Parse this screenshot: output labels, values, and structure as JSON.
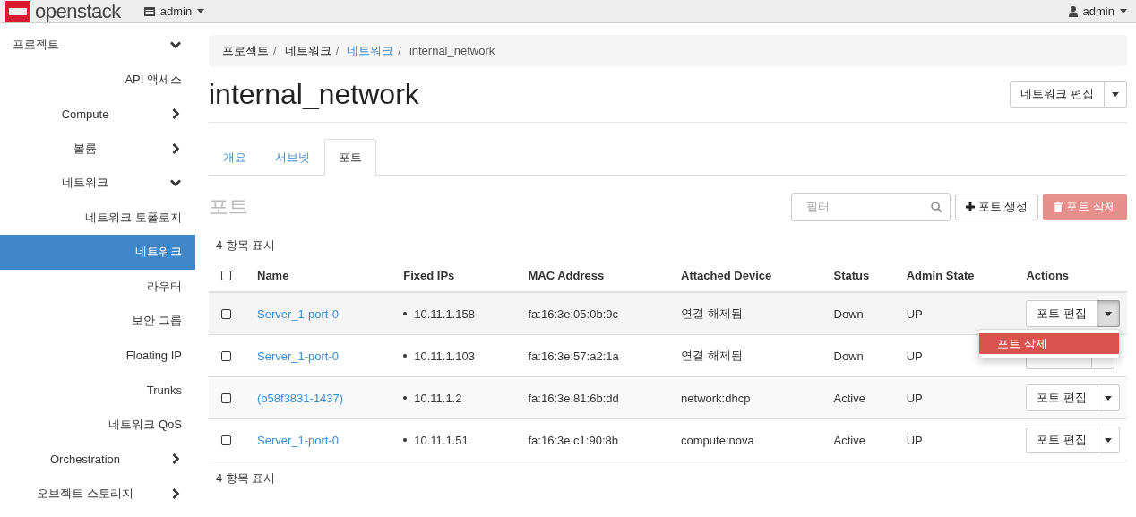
{
  "topbar": {
    "brand": "openstack",
    "project_menu": "admin",
    "user_menu": "admin"
  },
  "sidebar": {
    "items": [
      {
        "label": "프로젝트",
        "expanded": true,
        "children": [
          {
            "label": "API 액세스",
            "selected": false
          },
          {
            "label": "Compute",
            "expanded": false
          },
          {
            "label": "볼륨",
            "expanded": false
          },
          {
            "label": "네트워크",
            "expanded": true,
            "children": [
              {
                "label": "네트워크 토폴로지",
                "selected": false
              },
              {
                "label": "네트워크",
                "selected": true
              },
              {
                "label": "라우터",
                "selected": false
              },
              {
                "label": "보안 그룹",
                "selected": false
              },
              {
                "label": "Floating IP",
                "selected": false
              },
              {
                "label": "Trunks",
                "selected": false
              },
              {
                "label": "네트워크 QoS",
                "selected": false
              }
            ]
          },
          {
            "label": "Orchestration",
            "expanded": false
          },
          {
            "label": "오브젝트 스토리지",
            "expanded": false
          }
        ]
      }
    ]
  },
  "breadcrumb": {
    "separator": "/",
    "items": [
      {
        "label": "프로젝트",
        "link": false
      },
      {
        "label": "네트워크",
        "link": false
      },
      {
        "label": "네트워크",
        "link": true
      },
      {
        "label": "internal_network",
        "link": false
      }
    ]
  },
  "page_title": "internal_network",
  "header_action": "네트워크 편집",
  "tabs": [
    {
      "label": "개요",
      "selected": false
    },
    {
      "label": "서브넷",
      "selected": false
    },
    {
      "label": "포트",
      "selected": true
    }
  ],
  "section_title": "포트",
  "filter": {
    "placeholder": "필터"
  },
  "create_button": "포트 생성",
  "delete_button": {
    "label": "포트 삭제",
    "disabled": true
  },
  "count_top": "4 항목 표시",
  "table": {
    "select_all_checked": false,
    "columns": [
      "Name",
      "Fixed IPs",
      "MAC Address",
      "Attached Device",
      "Status",
      "Admin State",
      "Actions"
    ],
    "rows": [
      {
        "checked": false,
        "name": "Server_1-port-0",
        "ips": [
          "10.11.1.158"
        ],
        "mac": "fa:16:3e:05:0b:9c",
        "device": "연결 해제됨",
        "status": "Down",
        "admin_state": "UP",
        "action": "포트 편집",
        "menu_open": true,
        "menu": [
          {
            "label": "포트 삭제",
            "kind": "danger"
          }
        ]
      },
      {
        "checked": false,
        "name": "Server_1-port-0",
        "ips": [
          "10.11.1.103"
        ],
        "mac": "fa:16:3e:57:a2:1a",
        "device": "연결 해제됨",
        "status": "Down",
        "admin_state": "UP",
        "menu_open": false
      },
      {
        "checked": false,
        "name": "(b58f3831-1437)",
        "ips": [
          "10.11.1.2"
        ],
        "mac": "fa:16:3e:81:6b:dd",
        "device": "network:dhcp",
        "status": "Active",
        "admin_state": "UP",
        "action": "포트 편집",
        "menu_open": false
      },
      {
        "checked": false,
        "name": "Server_1-port-0",
        "ips": [
          "10.11.1.51"
        ],
        "mac": "fa:16:3e:c1:90:8b",
        "device": "compute:nova",
        "status": "Active",
        "admin_state": "UP",
        "action": "포트 편집",
        "menu_open": false
      }
    ]
  },
  "count_bottom": "4 항목 표시"
}
